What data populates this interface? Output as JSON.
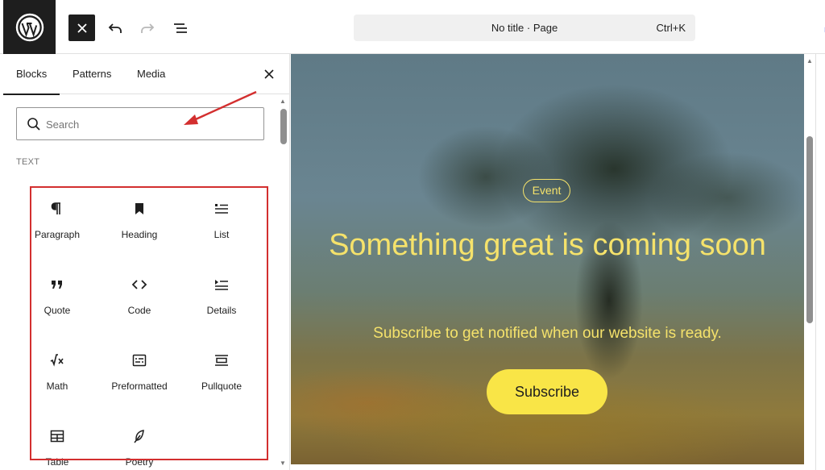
{
  "toolbar": {
    "logo_icon": "wordpress-logo-icon",
    "close_icon": "close-icon",
    "undo_icon": "undo-icon",
    "redo_icon": "redo-icon",
    "outline_icon": "document-overview-icon",
    "command_title": "No title · Page",
    "command_shortcut": "Ctrl+K",
    "edge_glyph": "≡"
  },
  "inserter": {
    "tabs": [
      {
        "label": "Blocks",
        "active": true
      },
      {
        "label": "Patterns",
        "active": false
      },
      {
        "label": "Media",
        "active": false
      }
    ],
    "close_icon": "close-icon",
    "search": {
      "placeholder": "Search",
      "value": ""
    },
    "category": "TEXT",
    "blocks": [
      {
        "label": "Paragraph",
        "icon": "paragraph-icon"
      },
      {
        "label": "Heading",
        "icon": "heading-bookmark-icon"
      },
      {
        "label": "List",
        "icon": "list-icon"
      },
      {
        "label": "Quote",
        "icon": "quote-icon"
      },
      {
        "label": "Code",
        "icon": "code-icon"
      },
      {
        "label": "Details",
        "icon": "details-icon"
      },
      {
        "label": "Math",
        "icon": "math-icon"
      },
      {
        "label": "Preformatted",
        "icon": "preformatted-icon"
      },
      {
        "label": "Pullquote",
        "icon": "pullquote-icon"
      },
      {
        "label": "Table",
        "icon": "table-icon"
      },
      {
        "label": "Poetry",
        "icon": "poetry-feather-icon"
      }
    ]
  },
  "canvas": {
    "event_label": "Event",
    "headline": "Something great is coming soon",
    "subline": "Subscribe to get notified when our website is ready.",
    "button_label": "Subscribe",
    "accent": "#f5e26b",
    "button_color": "#f9e547"
  },
  "annotations": {
    "highlight_color": "#d32f2f"
  }
}
